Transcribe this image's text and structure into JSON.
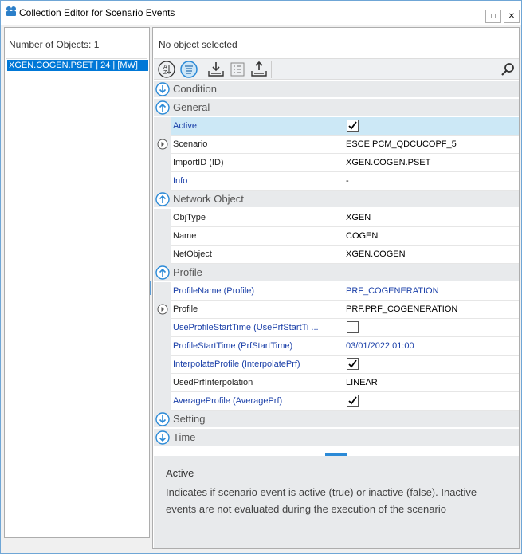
{
  "window": {
    "title": "Collection Editor for Scenario Events",
    "maximize_glyph": "□",
    "close_glyph": "✕"
  },
  "left": {
    "count_label": "Number of Objects: 1",
    "items": [
      "XGEN.COGEN.PSET | 24 | [MW]"
    ]
  },
  "right": {
    "status": "No object selected",
    "toolbar": [
      "sort-alphabetical-icon",
      "sort-categorized-icon",
      "import-icon",
      "list-icon",
      "export-icon",
      "search-icon"
    ],
    "categories": {
      "condition": "Condition",
      "general": "General",
      "network": "Network Object",
      "profile": "Profile",
      "setting": "Setting",
      "time": "Time"
    },
    "general": [
      {
        "name": "Active",
        "value": "",
        "checked": true
      },
      {
        "name": "Scenario",
        "value": "ESCE.PCM_QDCUCOPF_5"
      },
      {
        "name": "ImportID (ID)",
        "value": "XGEN.COGEN.PSET"
      },
      {
        "name": "Info",
        "value": "-"
      }
    ],
    "network": [
      {
        "name": "ObjType",
        "value": "XGEN"
      },
      {
        "name": "Name",
        "value": "COGEN"
      },
      {
        "name": "NetObject",
        "value": "XGEN.COGEN"
      }
    ],
    "profile": [
      {
        "name": "ProfileName (Profile)",
        "value": "PRF_COGENERATION"
      },
      {
        "name": "Profile",
        "value": "PRF.PRF_COGENERATION"
      },
      {
        "name": "UseProfileStartTime  (UsePrfStartTi ...",
        "value": "",
        "checked": false
      },
      {
        "name": "ProfileStartTime (PrfStartTime)",
        "value": "03/01/2022 01:00"
      },
      {
        "name": "InterpolateProfile (InterpolatePrf)",
        "value": "",
        "checked": true
      },
      {
        "name": "UsedPrfInterpolation",
        "value": "LINEAR"
      },
      {
        "name": "AverageProfile (AveragePrf)",
        "value": "",
        "checked": true
      }
    ],
    "description": {
      "title": "Active",
      "text": "Indicates if scenario event is active (true) or inactive (false). Inactive events are not evaluated during the execution of the scenario"
    }
  },
  "colors": {
    "selection": "#0078d7",
    "row_highlight": "#cce8f6",
    "category_bg": "#e8eaec",
    "accent_blue": "#1a3fa8"
  }
}
